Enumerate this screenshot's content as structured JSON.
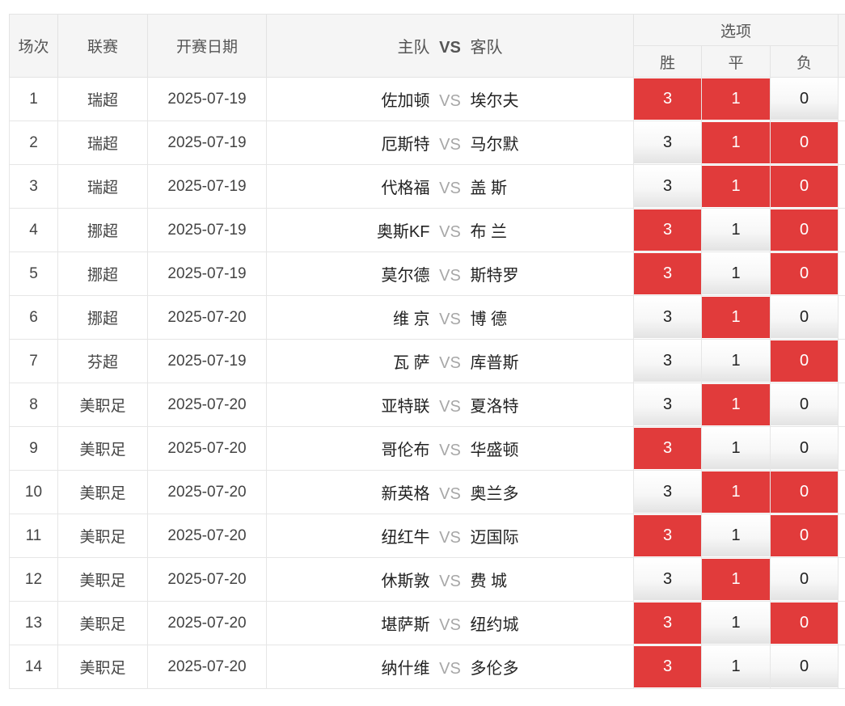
{
  "colors": {
    "selected": "#e13b3b",
    "header_bg": "#f5f5f5",
    "border": "#e6e6e6",
    "vs_text": "#a7a7a7"
  },
  "header": {
    "seq": "场次",
    "league": "联赛",
    "date": "开赛日期",
    "home": "主队",
    "vs": "VS",
    "away": "客队",
    "options": "选项",
    "win": "胜",
    "draw": "平",
    "loss": "负"
  },
  "rows": [
    {
      "seq": "1",
      "league": "瑞超",
      "date": "2025-07-19",
      "home": "佐加顿",
      "away": "埃尔夫",
      "vs": "VS",
      "win": "3",
      "draw": "1",
      "loss": "0",
      "sel": [
        true,
        true,
        false
      ]
    },
    {
      "seq": "2",
      "league": "瑞超",
      "date": "2025-07-19",
      "home": "厄斯特",
      "away": "马尔默",
      "vs": "VS",
      "win": "3",
      "draw": "1",
      "loss": "0",
      "sel": [
        false,
        true,
        true
      ]
    },
    {
      "seq": "3",
      "league": "瑞超",
      "date": "2025-07-19",
      "home": "代格福",
      "away": "盖 斯",
      "vs": "VS",
      "win": "3",
      "draw": "1",
      "loss": "0",
      "sel": [
        false,
        true,
        true
      ]
    },
    {
      "seq": "4",
      "league": "挪超",
      "date": "2025-07-19",
      "home": "奥斯KF",
      "away": "布 兰",
      "vs": "VS",
      "win": "3",
      "draw": "1",
      "loss": "0",
      "sel": [
        true,
        false,
        true
      ]
    },
    {
      "seq": "5",
      "league": "挪超",
      "date": "2025-07-19",
      "home": "莫尔德",
      "away": "斯特罗",
      "vs": "VS",
      "win": "3",
      "draw": "1",
      "loss": "0",
      "sel": [
        true,
        false,
        true
      ]
    },
    {
      "seq": "6",
      "league": "挪超",
      "date": "2025-07-20",
      "home": "维 京",
      "away": "博 德",
      "vs": "VS",
      "win": "3",
      "draw": "1",
      "loss": "0",
      "sel": [
        false,
        true,
        false
      ]
    },
    {
      "seq": "7",
      "league": "芬超",
      "date": "2025-07-19",
      "home": "瓦 萨",
      "away": "库普斯",
      "vs": "VS",
      "win": "3",
      "draw": "1",
      "loss": "0",
      "sel": [
        false,
        false,
        true
      ]
    },
    {
      "seq": "8",
      "league": "美职足",
      "date": "2025-07-20",
      "home": "亚特联",
      "away": "夏洛特",
      "vs": "VS",
      "win": "3",
      "draw": "1",
      "loss": "0",
      "sel": [
        false,
        true,
        false
      ]
    },
    {
      "seq": "9",
      "league": "美职足",
      "date": "2025-07-20",
      "home": "哥伦布",
      "away": "华盛顿",
      "vs": "VS",
      "win": "3",
      "draw": "1",
      "loss": "0",
      "sel": [
        true,
        false,
        false
      ]
    },
    {
      "seq": "10",
      "league": "美职足",
      "date": "2025-07-20",
      "home": "新英格",
      "away": "奥兰多",
      "vs": "VS",
      "win": "3",
      "draw": "1",
      "loss": "0",
      "sel": [
        false,
        true,
        true
      ]
    },
    {
      "seq": "11",
      "league": "美职足",
      "date": "2025-07-20",
      "home": "纽红牛",
      "away": "迈国际",
      "vs": "VS",
      "win": "3",
      "draw": "1",
      "loss": "0",
      "sel": [
        true,
        false,
        true
      ]
    },
    {
      "seq": "12",
      "league": "美职足",
      "date": "2025-07-20",
      "home": "休斯敦",
      "away": "费 城",
      "vs": "VS",
      "win": "3",
      "draw": "1",
      "loss": "0",
      "sel": [
        false,
        true,
        false
      ]
    },
    {
      "seq": "13",
      "league": "美职足",
      "date": "2025-07-20",
      "home": "堪萨斯",
      "away": "纽约城",
      "vs": "VS",
      "win": "3",
      "draw": "1",
      "loss": "0",
      "sel": [
        true,
        false,
        true
      ]
    },
    {
      "seq": "14",
      "league": "美职足",
      "date": "2025-07-20",
      "home": "纳什维",
      "away": "多伦多",
      "vs": "VS",
      "win": "3",
      "draw": "1",
      "loss": "0",
      "sel": [
        true,
        false,
        false
      ]
    }
  ]
}
